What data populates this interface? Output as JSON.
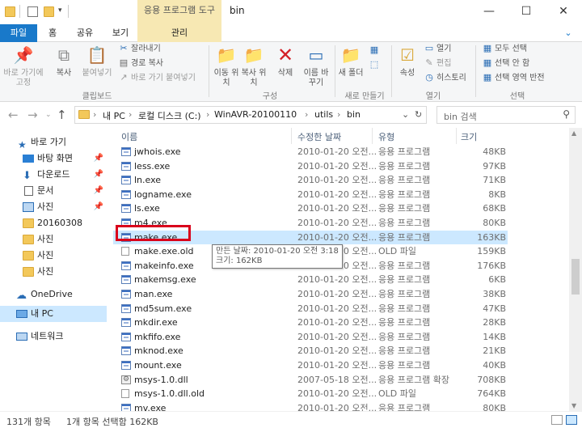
{
  "window": {
    "title": "bin",
    "context_tab": "응용 프로그램 도구",
    "minimize": "—",
    "maximize": "☐",
    "close": "✕"
  },
  "tabs": {
    "file": "파일",
    "home": "홈",
    "share": "공유",
    "view": "보기",
    "manage": "관리"
  },
  "ribbon": {
    "clipboard": {
      "pin_label": "바로 가기에 고정",
      "copy_label": "복사",
      "paste_label": "붙여넣기",
      "cut_label": "잘라내기",
      "copy_path_label": "경로 복사",
      "paste_shortcut_label": "바로 가기 붙여넣기",
      "group_label": "클립보드"
    },
    "organize": {
      "move_to_label": "이동 위치",
      "copy_to_label": "복사 위치",
      "delete_label": "삭제",
      "rename_label": "이름 바꾸기",
      "group_label": "구성"
    },
    "new": {
      "new_folder_label": "새 폴더",
      "group_label": "새로 만들기"
    },
    "open": {
      "properties_label": "속성",
      "open_label": "열기",
      "edit_label": "편집",
      "history_label": "히스토리",
      "group_label": "열기"
    },
    "select": {
      "select_all_label": "모두 선택",
      "select_none_label": "선택 안 함",
      "invert_label": "선택 영역 반전",
      "group_label": "선택"
    }
  },
  "address": {
    "crumbs": [
      "내 PC",
      "로컬 디스크 (C:)",
      "WinAVR-20100110",
      "utils",
      "bin"
    ],
    "search_placeholder": "bin 검색"
  },
  "nav": {
    "quick_access": "바로 가기",
    "items": [
      {
        "label": "바탕 화면",
        "icon": "desktop-icon",
        "pinned": true
      },
      {
        "label": "다운로드",
        "icon": "download-icon",
        "pinned": true
      },
      {
        "label": "문서",
        "icon": "document-icon",
        "pinned": true
      },
      {
        "label": "사진",
        "icon": "pictures-icon",
        "pinned": true
      },
      {
        "label": "20160308",
        "icon": "folder-icon",
        "pinned": false
      },
      {
        "label": "사진",
        "icon": "folder-icon",
        "pinned": false
      },
      {
        "label": "사진",
        "icon": "folder-icon",
        "pinned": false
      },
      {
        "label": "사진",
        "icon": "folder-icon",
        "pinned": false
      }
    ],
    "onedrive": "OneDrive",
    "this_pc": "내 PC",
    "network": "네트워크"
  },
  "columns": {
    "name": "이름",
    "date": "수정한 날짜",
    "type": "유형",
    "size": "크기"
  },
  "files": [
    {
      "name": "jwhois.exe",
      "date": "2010-01-20 오전...",
      "type": "응용 프로그램",
      "size": "48KB",
      "icon": "exe"
    },
    {
      "name": "less.exe",
      "date": "2010-01-20 오전...",
      "type": "응용 프로그램",
      "size": "97KB",
      "icon": "exe"
    },
    {
      "name": "ln.exe",
      "date": "2010-01-20 오전...",
      "type": "응용 프로그램",
      "size": "71KB",
      "icon": "exe"
    },
    {
      "name": "logname.exe",
      "date": "2010-01-20 오전...",
      "type": "응용 프로그램",
      "size": "8KB",
      "icon": "exe"
    },
    {
      "name": "ls.exe",
      "date": "2010-01-20 오전...",
      "type": "응용 프로그램",
      "size": "68KB",
      "icon": "exe"
    },
    {
      "name": "m4.exe",
      "date": "2010-01-20 오전...",
      "type": "응용 프로그램",
      "size": "80KB",
      "icon": "exe"
    },
    {
      "name": "make.exe",
      "date": "2010-01-20 오전...",
      "type": "응용 프로그램",
      "size": "163KB",
      "icon": "exe",
      "selected": true
    },
    {
      "name": "make.exe.old",
      "date": "2010-01-20 오전...",
      "type": "OLD 파일",
      "size": "159KB",
      "icon": "doc"
    },
    {
      "name": "makeinfo.exe",
      "date": "2010-01-20 오전...",
      "type": "응용 프로그램",
      "size": "176KB",
      "icon": "exe"
    },
    {
      "name": "makemsg.exe",
      "date": "2010-01-20 오전...",
      "type": "응용 프로그램",
      "size": "6KB",
      "icon": "exe"
    },
    {
      "name": "man.exe",
      "date": "2010-01-20 오전...",
      "type": "응용 프로그램",
      "size": "38KB",
      "icon": "exe"
    },
    {
      "name": "md5sum.exe",
      "date": "2010-01-20 오전...",
      "type": "응용 프로그램",
      "size": "47KB",
      "icon": "exe"
    },
    {
      "name": "mkdir.exe",
      "date": "2010-01-20 오전...",
      "type": "응용 프로그램",
      "size": "28KB",
      "icon": "exe"
    },
    {
      "name": "mkfifo.exe",
      "date": "2010-01-20 오전...",
      "type": "응용 프로그램",
      "size": "14KB",
      "icon": "exe"
    },
    {
      "name": "mknod.exe",
      "date": "2010-01-20 오전...",
      "type": "응용 프로그램",
      "size": "21KB",
      "icon": "exe"
    },
    {
      "name": "mount.exe",
      "date": "2010-01-20 오전...",
      "type": "응용 프로그램",
      "size": "40KB",
      "icon": "exe"
    },
    {
      "name": "msys-1.0.dll",
      "date": "2007-05-18 오전...",
      "type": "응용 프로그램 확장",
      "size": "708KB",
      "icon": "dll"
    },
    {
      "name": "msys-1.0.dll.old",
      "date": "2010-01-20 오전...",
      "type": "OLD 파일",
      "size": "764KB",
      "icon": "doc"
    },
    {
      "name": "mv.exe",
      "date": "2010-01-20 오전...",
      "type": "응용 프로그램",
      "size": "80KB",
      "icon": "exe"
    }
  ],
  "tooltip": {
    "line1": "만든 날짜: 2010-01-20 오전 3:18",
    "line2": "크기: 162KB"
  },
  "status": {
    "count": "131개 항목",
    "selection": "1개 항목 선택함 162KB"
  },
  "colors": {
    "accent": "#1979ca",
    "selection": "#cce8ff",
    "context_tab": "#f7e8b3",
    "highlight_box": "#d9001b"
  }
}
